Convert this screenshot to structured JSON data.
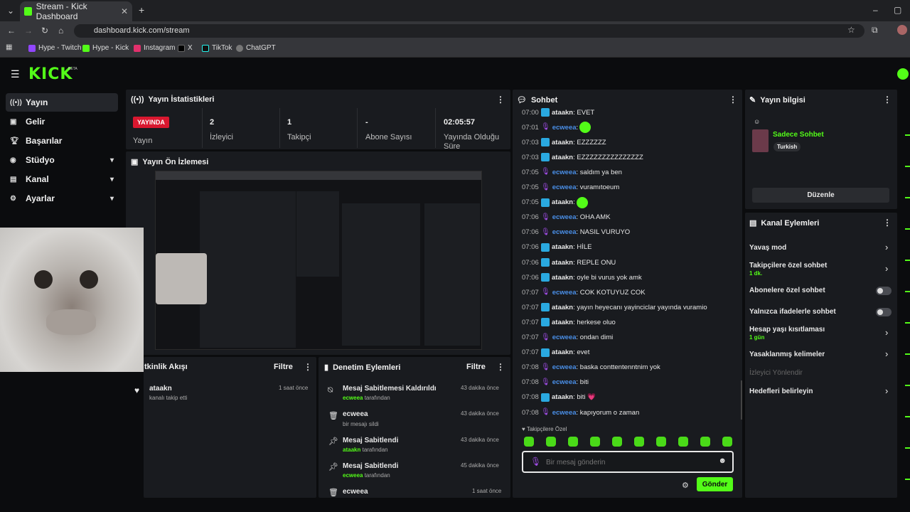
{
  "browser": {
    "tab_title": "Stream - Kick Dashboard",
    "url": "dashboard.kick.com/stream",
    "bookmarks": [
      "Hype - Twitch",
      "Hype - Kick",
      "Instagram",
      "X",
      "TikTok",
      "ChatGPT"
    ]
  },
  "brand": {
    "logo": "KICK",
    "beta": "BETA",
    "accent": "#53fc18"
  },
  "nav": [
    {
      "label": "Yayın",
      "icon": "broadcast-icon",
      "active": true
    },
    {
      "label": "Gelir",
      "icon": "wallet-icon"
    },
    {
      "label": "Başarılar",
      "icon": "trophy-icon"
    },
    {
      "label": "Stüdyo",
      "icon": "studio-icon"
    },
    {
      "label": "Kanal",
      "icon": "channel-icon"
    },
    {
      "label": "Ayarlar",
      "icon": "gear-icon"
    }
  ],
  "stats": {
    "title": "Yayın İstatistikleri",
    "live_badge": "YAYINDA",
    "live_label": "Yayın",
    "viewers": "2",
    "viewers_label": "İzleyici",
    "followers": "1",
    "followers_label": "Takipçi",
    "subs": "-",
    "subs_label": "Abone Sayısı",
    "duration": "02:05:57",
    "duration_label": "Yayında Olduğu Süre"
  },
  "preview": {
    "title": "Yayın Ön İzlemesi"
  },
  "activity": {
    "title": "tkinlik Akışı",
    "filter": "Filtre",
    "items": [
      {
        "user": "ataakn",
        "text": "kanalı takip etti",
        "time": "1 saat önce"
      }
    ]
  },
  "moderation": {
    "title": "Denetim Eylemleri",
    "filter": "Filtre",
    "items": [
      {
        "title": "Mesaj Sabitlemesi Kaldırıldı",
        "user": "ecweea",
        "suffix": "tarafından",
        "time": "43 dakika önce"
      },
      {
        "title": "ecweea",
        "user": "",
        "suffix": "bir mesajı sildi",
        "time": "43 dakika önce"
      },
      {
        "title": "Mesaj Sabitlendi",
        "user": "ataakn",
        "suffix": "tarafından",
        "time": "43 dakika önce"
      },
      {
        "title": "Mesaj Sabitlendi",
        "user": "ecweea",
        "suffix": "tarafından",
        "time": "45 dakika önce"
      },
      {
        "title": "ecweea",
        "user": "",
        "suffix": "",
        "time": "1 saat önce"
      }
    ]
  },
  "chat": {
    "title": "Sohbet",
    "messages": [
      {
        "t": "07:00",
        "u": "ataakn",
        "m": "EVET"
      },
      {
        "t": "07:01",
        "u": "ecweea",
        "m": ""
      },
      {
        "t": "07:03",
        "u": "ataakn",
        "m": "EZZZZZZ"
      },
      {
        "t": "07:03",
        "u": "ataakn",
        "m": "EZZZZZZZZZZZZZZZ"
      },
      {
        "t": "07:05",
        "u": "ecweea",
        "m": "saldım ya ben"
      },
      {
        "t": "07:05",
        "u": "ecweea",
        "m": "vuramıtoeum"
      },
      {
        "t": "07:05",
        "u": "ataakn",
        "m": ""
      },
      {
        "t": "07:06",
        "u": "ecweea",
        "m": "OHA AMK"
      },
      {
        "t": "07:06",
        "u": "ecweea",
        "m": "NASIL VURUYO"
      },
      {
        "t": "07:06",
        "u": "ataakn",
        "m": "HİLE"
      },
      {
        "t": "07:06",
        "u": "ataakn",
        "m": "REPLE ONU"
      },
      {
        "t": "07:06",
        "u": "ataakn",
        "m": "oyle bi vurus yok amk"
      },
      {
        "t": "07:07",
        "u": "ecweea",
        "m": "COK KOTUYUZ COK"
      },
      {
        "t": "07:07",
        "u": "ataakn",
        "m": "yayın heyecanı yayinciclar yayında vuramio"
      },
      {
        "t": "07:07",
        "u": "ataakn",
        "m": "herkese oluo"
      },
      {
        "t": "07:07",
        "u": "ecweea",
        "m": "ondan dimi"
      },
      {
        "t": "07:07",
        "u": "ataakn",
        "m": "evet"
      },
      {
        "t": "07:08",
        "u": "ecweea",
        "m": "baska conttentenntnim yok"
      },
      {
        "t": "07:08",
        "u": "ecweea",
        "m": "biti"
      },
      {
        "t": "07:08",
        "u": "ataakn",
        "m": "biti 💗"
      },
      {
        "t": "07:08",
        "u": "ecweea",
        "m": "kapıyorum o zaman"
      }
    ],
    "followers_only": "Takipçilere Özel",
    "placeholder": "Bir mesaj gönderin",
    "send": "Gönder"
  },
  "stream_info": {
    "title": "Yayın bilgisi",
    "stream_title": "Sadece Sohbet",
    "tag": "Turkish",
    "edit": "Düzenle"
  },
  "channel_actions": {
    "title": "Kanal Eylemleri",
    "slow": "Yavaş mod",
    "followers": "Takipçilere özel sohbet",
    "followers_sub": "1 dk.",
    "subs": "Abonelere özel sohbet",
    "emotes": "Yalnızca ifadelerle sohbet",
    "age": "Hesap yaşı kısıtlaması",
    "age_sub": "1 gün",
    "banned": "Yasaklanmış kelimeler",
    "redirect": "İzleyici Yönlendir",
    "goals": "Hedefleri belirleyin"
  }
}
